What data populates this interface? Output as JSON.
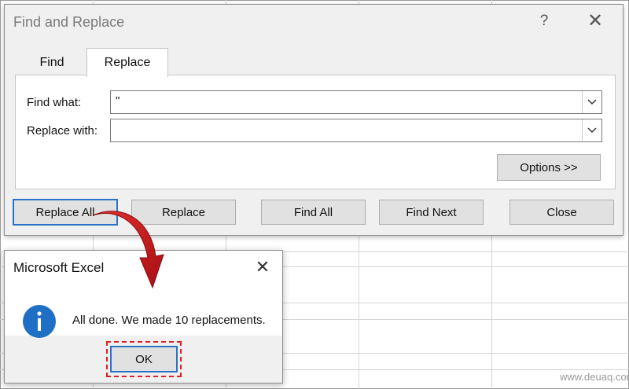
{
  "find_replace": {
    "title": "Find and Replace",
    "help": "?",
    "close": "✕",
    "tabs": {
      "find": "Find",
      "replace": "Replace"
    },
    "find_what_label": "Find what:",
    "find_what_value": "\"",
    "replace_with_label": "Replace with:",
    "replace_with_value": "",
    "options_button": "Options >>",
    "buttons": {
      "replace_all": "Replace All",
      "replace": "Replace",
      "find_all": "Find All",
      "find_next": "Find Next",
      "close": "Close"
    }
  },
  "message_box": {
    "title": "Microsoft Excel",
    "close": "✕",
    "message": "All done. We made 10 replacements.",
    "ok": "OK",
    "icon": "info-icon"
  },
  "annotation": {
    "arrow_color": "#c8151b",
    "outline_color": "#e01e1e"
  },
  "watermark": "www.deuaq.com"
}
